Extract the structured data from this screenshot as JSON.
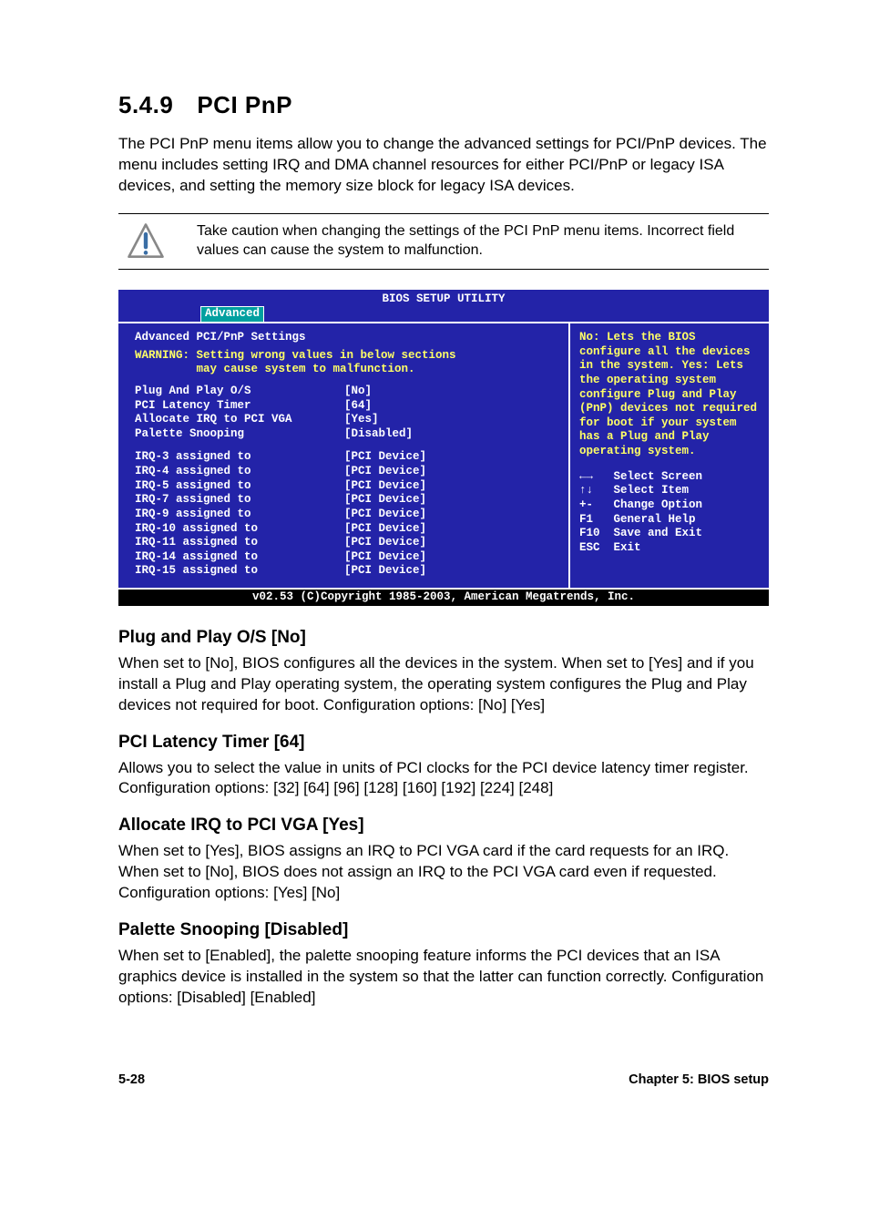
{
  "section": {
    "number": "5.4.9",
    "title": "PCI PnP"
  },
  "intro": "The PCI PnP menu items allow you to change the advanced settings for PCI/PnP devices. The menu includes setting IRQ and DMA channel resources for either PCI/PnP or legacy ISA devices, and setting the memory size block for legacy ISA devices.",
  "caution": "Take caution when changing the settings of the PCI PnP menu items. Incorrect field values can cause the system to malfunction.",
  "bios": {
    "title": "BIOS SETUP UTILITY",
    "tab": "Advanced",
    "heading": "Advanced PCI/PnP Settings",
    "warning_l1": "WARNING: Setting wrong values in below sections",
    "warning_l2": "         may cause system to malfunction.",
    "settings": [
      {
        "label": "Plug And Play O/S",
        "value": "[No]"
      },
      {
        "label": "PCI Latency Timer",
        "value": "[64]"
      },
      {
        "label": "Allocate IRQ to PCI VGA",
        "value": "[Yes]"
      },
      {
        "label": "Palette Snooping",
        "value": "[Disabled]"
      }
    ],
    "irq": [
      {
        "label": "IRQ-3 assigned to",
        "value": "[PCI Device]"
      },
      {
        "label": "IRQ-4 assigned to",
        "value": "[PCI Device]"
      },
      {
        "label": "IRQ-5 assigned to",
        "value": "[PCI Device]"
      },
      {
        "label": "IRQ-7 assigned to",
        "value": "[PCI Device]"
      },
      {
        "label": "IRQ-9 assigned to",
        "value": "[PCI Device]"
      },
      {
        "label": "IRQ-10 assigned to",
        "value": "[PCI Device]"
      },
      {
        "label": "IRQ-11 assigned to",
        "value": "[PCI Device]"
      },
      {
        "label": "IRQ-14 assigned to",
        "value": "[PCI Device]"
      },
      {
        "label": "IRQ-15 assigned to",
        "value": "[PCI Device]"
      }
    ],
    "help": "No: Lets the BIOS configure all the devices in the system. Yes: Lets the operating system configure Plug and Play (PnP) devices not required for boot if your system has a Plug and Play operating system.",
    "legend": [
      {
        "key": "←→",
        "label": "Select Screen"
      },
      {
        "key": "↑↓",
        "label": "Select Item"
      },
      {
        "key": "+-",
        "label": "Change Option"
      },
      {
        "key": "F1",
        "label": "General Help"
      },
      {
        "key": "F10",
        "label": "Save and Exit"
      },
      {
        "key": "ESC",
        "label": "Exit"
      }
    ],
    "footer": "v02.53 (C)Copyright 1985-2003, American Megatrends, Inc."
  },
  "subs": [
    {
      "title": "Plug and Play O/S [No]",
      "body": "When set to [No], BIOS configures all the devices in the system. When set to [Yes] and if you install a Plug and Play operating system, the operating system configures the Plug and Play devices not required for boot. Configuration options: [No] [Yes]"
    },
    {
      "title": "PCI Latency Timer [64]",
      "body": "Allows you to select the value in units of PCI clocks for the PCI device latency timer register. Configuration options: [32] [64] [96] [128] [160] [192] [224] [248]"
    },
    {
      "title": "Allocate IRQ to PCI VGA [Yes]",
      "body": "When set to [Yes], BIOS assigns an IRQ to PCI VGA card if the card requests for an IRQ. When set to [No], BIOS does not assign an IRQ to the PCI VGA card even if requested. Configuration options: [Yes] [No]"
    },
    {
      "title": "Palette Snooping [Disabled]",
      "body": "When set to [Enabled], the palette snooping feature informs the PCI devices that an ISA graphics device is installed in the system so that the latter can function correctly. Configuration options: [Disabled] [Enabled]"
    }
  ],
  "footer": {
    "left": "5-28",
    "right": "Chapter 5: BIOS setup"
  }
}
